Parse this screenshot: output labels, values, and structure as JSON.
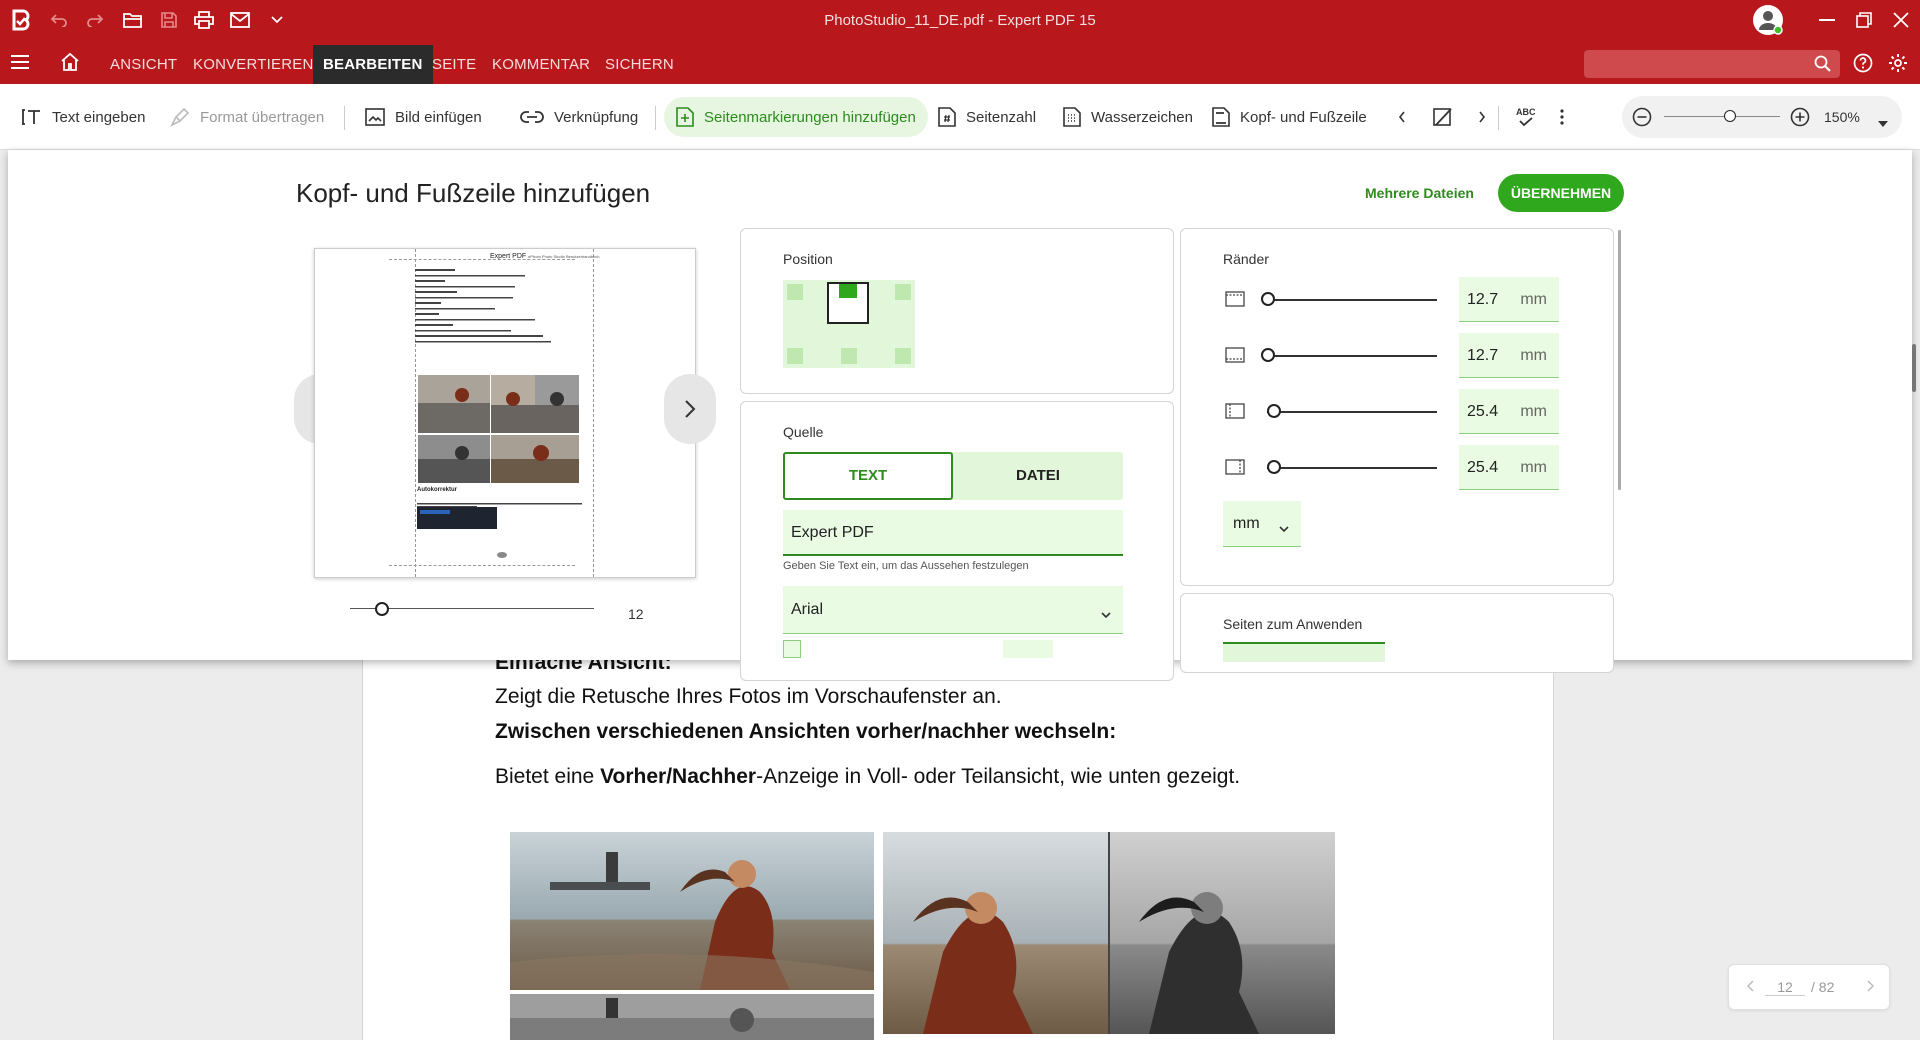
{
  "titlebar": {
    "title": "PhotoStudio_11_DE.pdf  -  Expert PDF 15"
  },
  "menu": {
    "tabs": [
      "ANSICHT",
      "KONVERTIEREN",
      "BEARBEITEN",
      "SEITE",
      "KOMMENTAR",
      "SICHERN"
    ],
    "active_tab": "BEARBEITEN"
  },
  "ribbon": {
    "text_eingeben": "Text eingeben",
    "format_uebertragen": "Format übertragen",
    "bild_einfuegen": "Bild einfügen",
    "verknuepfung": "Verknüpfung",
    "seitenmarkierungen": "Seitenmarkierungen hinzufügen",
    "seitenzahl": "Seitenzahl",
    "wasserzeichen": "Wasserzeichen",
    "kopf_fusszeile": "Kopf- und Fußzeile",
    "spell_abc": "ABC",
    "zoom_value": "150%"
  },
  "dialog": {
    "title": "Kopf- und Fußzeile hinzufügen",
    "mehrere_dateien": "Mehrere Dateien",
    "uebernehmen": "ÜBERNEHMEN",
    "preview": {
      "header_text": "Expert PDF",
      "header_small": "ePhoto Photo Studio Benutzerhandbuch",
      "section_heading": "Autokorrektur",
      "page_number": "12"
    },
    "position": {
      "label": "Position",
      "selected_cell": "top-center"
    },
    "quelle": {
      "label": "Quelle",
      "tab_text": "TEXT",
      "tab_datei": "DATEI",
      "text_value": "Expert PDF",
      "hint": "Geben Sie Text ein, um das Aussehen festzulegen",
      "font": "Arial"
    },
    "raender": {
      "label": "Ränder",
      "rows": [
        {
          "value": "12.7",
          "unit": "mm",
          "icon": "margin-top-icon"
        },
        {
          "value": "12.7",
          "unit": "mm",
          "icon": "margin-bottom-icon"
        },
        {
          "value": "25.4",
          "unit": "mm",
          "icon": "margin-left-icon"
        },
        {
          "value": "25.4",
          "unit": "mm",
          "icon": "margin-right-icon"
        }
      ],
      "unit_select": "mm"
    },
    "seiten": {
      "label": "Seiten zum Anwenden"
    }
  },
  "document": {
    "line1": "Einfache Ansicht:",
    "line2": "Zeigt die Retusche Ihres Fotos im Vorschaufenster an.",
    "line3": "Zwischen verschiedenen Ansichten vorher/nachher wechseln:",
    "line4_prefix": "Bietet eine ",
    "line4_bold": "Vorher/Nachher",
    "line4_suffix": "-Anzeige in Voll- oder Teilansicht, wie unten gezeigt."
  },
  "pagination": {
    "current": "12",
    "total": "/ 82"
  },
  "colors": {
    "brand_red": "#b8171b",
    "accent_green": "#2fa81d",
    "field_green": "#eafbe3"
  }
}
